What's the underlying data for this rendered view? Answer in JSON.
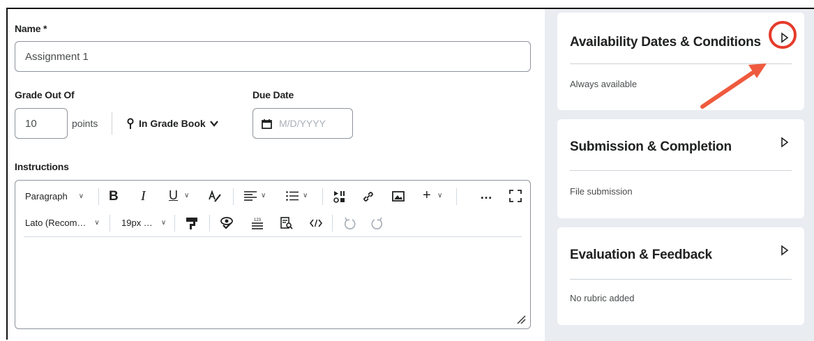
{
  "form": {
    "name_label": "Name *",
    "name_value": "Assignment 1",
    "grade_label": "Grade Out Of",
    "grade_value": "10",
    "points_label": "points",
    "in_grade_book_label": "In Grade Book",
    "due_date_label": "Due Date",
    "due_date_placeholder": "M/D/YYYY",
    "instructions_label": "Instructions"
  },
  "toolbar": {
    "paragraph_label": "Paragraph",
    "font_label": "Lato (Recom…",
    "size_label": "19px …",
    "bold": "B",
    "italic": "I",
    "underline": "U",
    "more": "…"
  },
  "panels": [
    {
      "title": "Availability Dates & Conditions",
      "summary": "Always available"
    },
    {
      "title": "Submission & Completion",
      "summary": "File submission"
    },
    {
      "title": "Evaluation & Feedback",
      "summary": "No rubric added"
    }
  ],
  "colors": {
    "highlight_circle": "#e53b2c",
    "arrow": "#ef5a3e",
    "border": "#8e949c"
  }
}
